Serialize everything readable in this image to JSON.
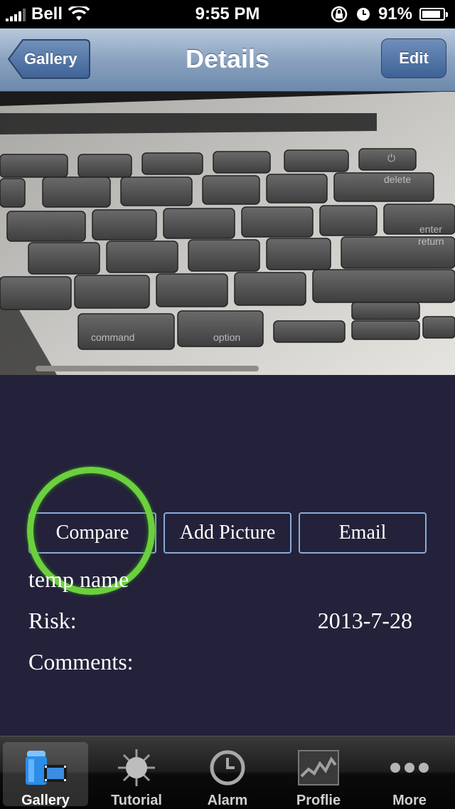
{
  "status": {
    "carrier": "Bell",
    "time": "9:55 PM",
    "battery": "91%",
    "battery_level": 0.91
  },
  "nav": {
    "title": "Details",
    "back_label": "Gallery",
    "edit_label": "Edit"
  },
  "photo": {
    "icon": "keyboard-photo"
  },
  "actions": {
    "compare_label": "Compare",
    "add_picture_label": "Add Picture",
    "email_label": "Email"
  },
  "details": {
    "name": "temp name",
    "risk_label": "Risk:",
    "date": "2013-7-28",
    "comments_label": "Comments:"
  },
  "tabs": [
    {
      "label": "Gallery",
      "icon": "gallery-icon",
      "active": true
    },
    {
      "label": "Tutorial",
      "icon": "sun-icon",
      "active": false
    },
    {
      "label": "Alarm",
      "icon": "clock-icon",
      "active": false
    },
    {
      "label": "Proflie",
      "icon": "chart-icon",
      "active": false
    },
    {
      "label": "More",
      "icon": "more-icon",
      "active": false
    }
  ],
  "colors": {
    "background": "#23223a",
    "button_border": "#8aa9d8",
    "highlight_ring": "#6bd03e",
    "nav_tint": "#6d89ab"
  }
}
